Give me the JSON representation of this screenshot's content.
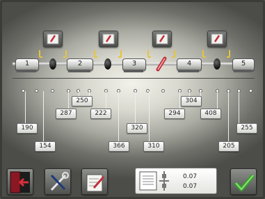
{
  "rolls": [
    {
      "label": "1"
    },
    {
      "label": "2"
    },
    {
      "label": "3"
    },
    {
      "label": "4"
    },
    {
      "label": "5"
    }
  ],
  "dimensions": {
    "top_row": [
      "250",
      "304"
    ],
    "middle_row": [
      "287",
      "222",
      "294",
      "408"
    ],
    "lower_row": [
      "190",
      "320",
      "255"
    ],
    "bottom_row": [
      "154",
      "366",
      "310",
      "205"
    ]
  },
  "readout": {
    "value_1": "0.07",
    "value_2": "0.07"
  },
  "toolbar": {
    "exit_icon": "exit-door-icon",
    "tools_icon": "wrench-screwdriver-icon",
    "notes_icon": "notepad-pencil-icon",
    "confirm_icon": "checkmark-icon"
  },
  "colors": {
    "edit_accent": "#c0303c",
    "confirm_green": "#3aa02e",
    "exit_red": "#b0202c"
  }
}
